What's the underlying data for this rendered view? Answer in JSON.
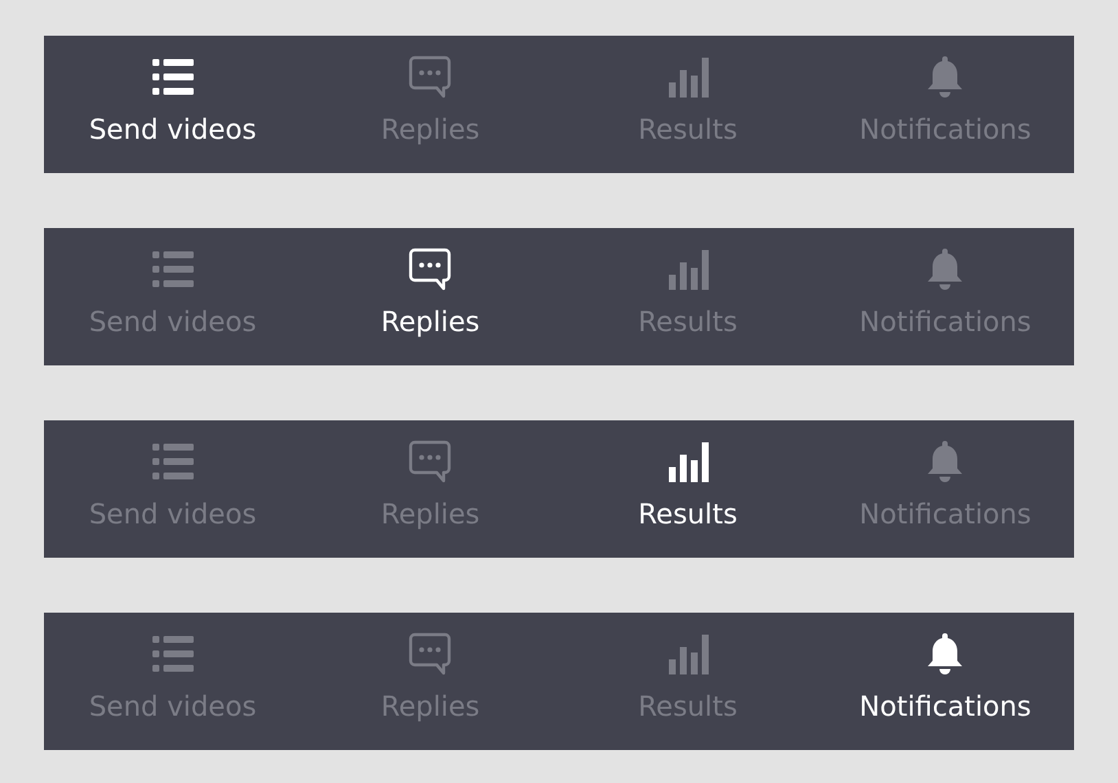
{
  "tab_bars": [
    {
      "tabs": [
        {
          "label": "Send videos",
          "kind": "list",
          "selected": true
        },
        {
          "label": "Replies",
          "kind": "chat",
          "selected": false
        },
        {
          "label": "Results",
          "kind": "bars",
          "selected": false
        },
        {
          "label": "Notifications",
          "kind": "bell",
          "selected": false
        }
      ]
    },
    {
      "tabs": [
        {
          "label": "Send videos",
          "kind": "list",
          "selected": false
        },
        {
          "label": "Replies",
          "kind": "chat",
          "selected": true
        },
        {
          "label": "Results",
          "kind": "bars",
          "selected": false
        },
        {
          "label": "Notifications",
          "kind": "bell",
          "selected": false
        }
      ]
    },
    {
      "tabs": [
        {
          "label": "Send videos",
          "kind": "list",
          "selected": false
        },
        {
          "label": "Replies",
          "kind": "chat",
          "selected": false
        },
        {
          "label": "Results",
          "kind": "bars",
          "selected": true
        },
        {
          "label": "Notifications",
          "kind": "bell",
          "selected": false
        }
      ]
    },
    {
      "tabs": [
        {
          "label": "Send videos",
          "kind": "list",
          "selected": false
        },
        {
          "label": "Replies",
          "kind": "chat",
          "selected": false
        },
        {
          "label": "Results",
          "kind": "bars",
          "selected": false
        },
        {
          "label": "Notifications",
          "kind": "bell",
          "selected": true
        }
      ]
    }
  ]
}
